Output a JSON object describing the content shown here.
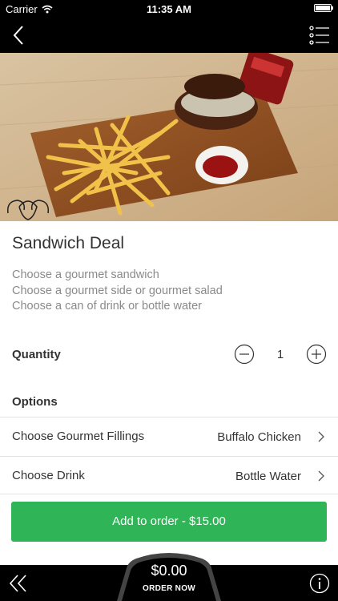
{
  "status_bar": {
    "carrier": "Carrier",
    "time": "11:35 AM"
  },
  "nav": {
    "back_icon": "chevron-left-icon",
    "menu_icon": "list-menu-icon"
  },
  "product": {
    "title": "Sandwich Deal",
    "description": [
      "Choose a gourmet sandwich",
      "Choose a gourmet side or gourmet salad",
      "Choose a can of drink or bottle water"
    ]
  },
  "quantity": {
    "label": "Quantity",
    "value": "1"
  },
  "options": {
    "label": "Options",
    "items": [
      {
        "label": "Choose Gourmet Fillings",
        "value": "Buffalo Chicken"
      },
      {
        "label": "Choose Drink",
        "value": "Bottle Water"
      }
    ]
  },
  "add_button": {
    "label": "Add to order - $15.00"
  },
  "footer": {
    "total": "$0.00",
    "order_now": "ORDER NOW"
  },
  "colors": {
    "accent": "#2fb457",
    "bar": "#000000",
    "text": "#333333",
    "muted": "#8a8a8a"
  }
}
